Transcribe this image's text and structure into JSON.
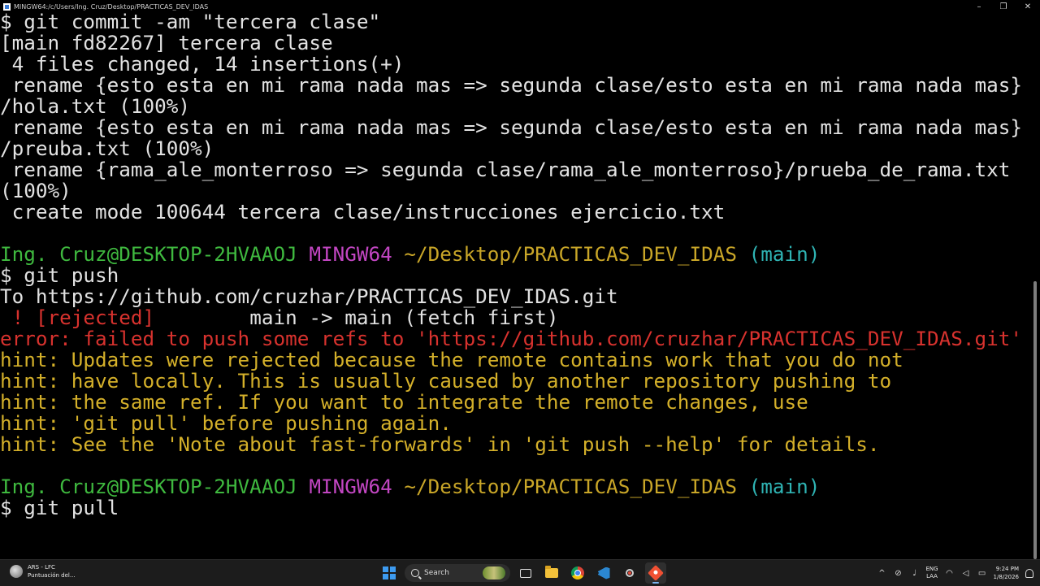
{
  "window": {
    "title": "MINGW64:/c/Users/Ing. Cruz/Desktop/PRACTICAS_DEV_IDAS",
    "controls": {
      "minimize": "–",
      "maximize": "❐",
      "close": "✕"
    }
  },
  "terminal": {
    "lines": [
      [
        {
          "t": "$ git commit -am \"tercera clase\"",
          "c": "white"
        }
      ],
      [
        {
          "t": "[main fd82267] tercera clase",
          "c": "white"
        }
      ],
      [
        {
          "t": " 4 files changed, 14 insertions(+)",
          "c": "white"
        }
      ],
      [
        {
          "t": " rename {esto esta en mi rama nada mas => segunda clase/esto esta en mi rama nada mas}",
          "c": "white"
        }
      ],
      [
        {
          "t": "/hola.txt (100%)",
          "c": "white"
        }
      ],
      [
        {
          "t": " rename {esto esta en mi rama nada mas => segunda clase/esto esta en mi rama nada mas}",
          "c": "white"
        }
      ],
      [
        {
          "t": "/preuba.txt (100%)",
          "c": "white"
        }
      ],
      [
        {
          "t": " rename {rama_ale_monterroso => segunda clase/rama_ale_monterroso}/prueba_de_rama.txt",
          "c": "white"
        }
      ],
      [
        {
          "t": "(100%)",
          "c": "white"
        }
      ],
      [
        {
          "t": " create mode 100644 tercera clase/instrucciones ejercicio.txt",
          "c": "white"
        }
      ],
      [
        {
          "t": "",
          "c": "white"
        }
      ],
      [
        {
          "t": "Ing. Cruz@DESKTOP-2HVAAOJ",
          "c": "green"
        },
        {
          "t": " ",
          "c": "white"
        },
        {
          "t": "MINGW64",
          "c": "magenta"
        },
        {
          "t": " ",
          "c": "white"
        },
        {
          "t": "~/Desktop/PRACTICAS_DEV_IDAS",
          "c": "yellow"
        },
        {
          "t": " ",
          "c": "white"
        },
        {
          "t": "(main)",
          "c": "cyan"
        }
      ],
      [
        {
          "t": "$ git push",
          "c": "white"
        }
      ],
      [
        {
          "t": "To https://github.com/cruzhar/PRACTICAS_DEV_IDAS.git",
          "c": "white"
        }
      ],
      [
        {
          "t": " ! [rejected]",
          "c": "red"
        },
        {
          "t": "        main -> main (fetch first)",
          "c": "white"
        }
      ],
      [
        {
          "t": "error: failed to push some refs to 'https://github.com/cruzhar/PRACTICAS_DEV_IDAS.git'",
          "c": "red"
        }
      ],
      [
        {
          "t": "hint: Updates were rejected because the remote contains work that you do not",
          "c": "hint"
        }
      ],
      [
        {
          "t": "hint: have locally. This is usually caused by another repository pushing to",
          "c": "hint"
        }
      ],
      [
        {
          "t": "hint: the same ref. If you want to integrate the remote changes, use",
          "c": "hint"
        }
      ],
      [
        {
          "t": "hint: 'git pull' before pushing again.",
          "c": "hint"
        }
      ],
      [
        {
          "t": "hint: See the 'Note about fast-forwards' in 'git push --help' for details.",
          "c": "hint"
        }
      ],
      [
        {
          "t": "",
          "c": "white"
        }
      ],
      [
        {
          "t": "Ing. Cruz@DESKTOP-2HVAAOJ",
          "c": "green"
        },
        {
          "t": " ",
          "c": "white"
        },
        {
          "t": "MINGW64",
          "c": "magenta"
        },
        {
          "t": " ",
          "c": "white"
        },
        {
          "t": "~/Desktop/PRACTICAS_DEV_IDAS",
          "c": "yellow"
        },
        {
          "t": " ",
          "c": "white"
        },
        {
          "t": "(main)",
          "c": "cyan"
        }
      ],
      [
        {
          "t": "$ git pull",
          "c": "white"
        }
      ]
    ]
  },
  "taskbar": {
    "news_line1": "ARS - LFC",
    "news_line2": "Puntuación del...",
    "search_placeholder": "Search",
    "apps": [
      "start-icon",
      "search",
      "task-view-icon",
      "file-explorer-icon",
      "chrome-icon",
      "vscode-icon",
      "snipping-tool-icon",
      "git-bash-icon"
    ],
    "tray": {
      "chevron": "^",
      "lang_line1": "ENG",
      "lang_line2": "LAA",
      "time": "9:24 PM",
      "date": "1/8/2026"
    }
  }
}
